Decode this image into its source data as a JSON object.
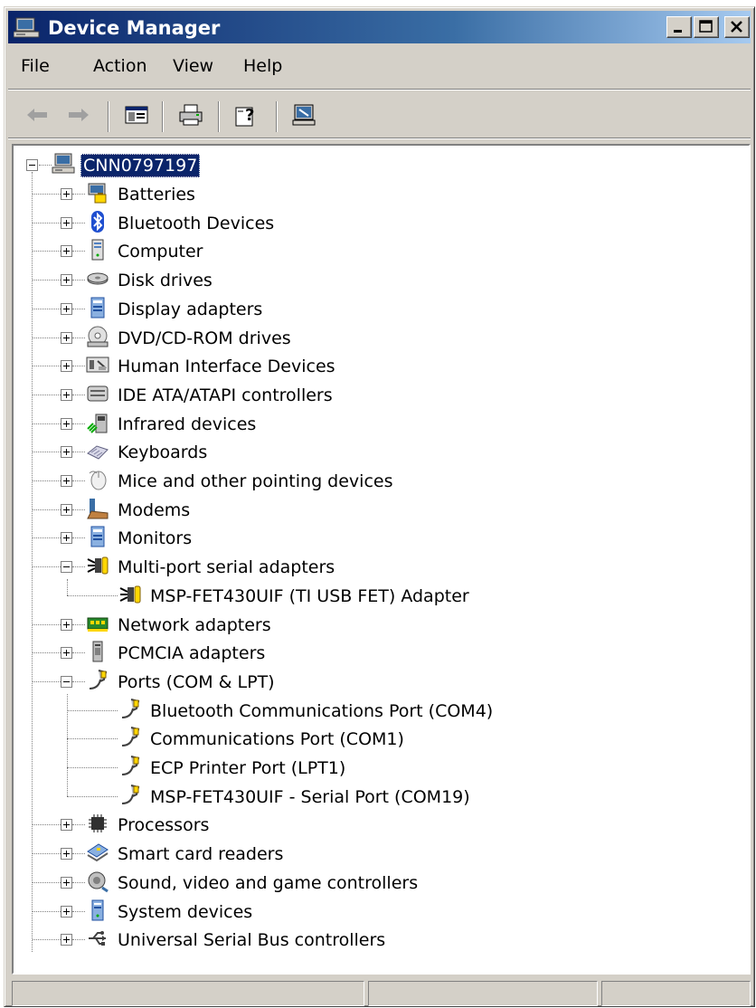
{
  "window": {
    "title": "Device Manager",
    "controls": [
      "minimize",
      "maximize",
      "close"
    ]
  },
  "menu": {
    "file": "File",
    "action": "Action",
    "view": "View",
    "help": "Help"
  },
  "toolbar": {
    "buttons": [
      "back-icon",
      "forward-icon",
      "show-hide-tree-icon",
      "print-icon",
      "help-icon",
      "properties-icon"
    ]
  },
  "tree": {
    "root": "CNN0797197",
    "nodes": [
      {
        "label": "Batteries",
        "icon": "battery-icon",
        "expanded": false
      },
      {
        "label": "Bluetooth Devices",
        "icon": "bluetooth-icon",
        "expanded": false
      },
      {
        "label": "Computer",
        "icon": "computer-icon",
        "expanded": false
      },
      {
        "label": "Disk drives",
        "icon": "disk-drive-icon",
        "expanded": false
      },
      {
        "label": "Display adapters",
        "icon": "display-adapter-icon",
        "expanded": false
      },
      {
        "label": "DVD/CD-ROM drives",
        "icon": "dvd-icon",
        "expanded": false
      },
      {
        "label": "Human Interface Devices",
        "icon": "hid-icon",
        "expanded": false
      },
      {
        "label": "IDE ATA/ATAPI controllers",
        "icon": "ide-controller-icon",
        "expanded": false
      },
      {
        "label": "Infrared devices",
        "icon": "infrared-icon",
        "expanded": false
      },
      {
        "label": "Keyboards",
        "icon": "keyboard-icon",
        "expanded": false
      },
      {
        "label": "Mice and other pointing devices",
        "icon": "mouse-icon",
        "expanded": false
      },
      {
        "label": "Modems",
        "icon": "modem-icon",
        "expanded": false
      },
      {
        "label": "Monitors",
        "icon": "monitor-icon",
        "expanded": false
      },
      {
        "label": "Multi-port serial adapters",
        "icon": "serial-adapter-icon",
        "expanded": true,
        "children": [
          {
            "label": "MSP-FET430UIF (TI USB FET) Adapter",
            "icon": "serial-adapter-icon"
          }
        ]
      },
      {
        "label": "Network adapters",
        "icon": "network-adapter-icon",
        "expanded": false
      },
      {
        "label": "PCMCIA adapters",
        "icon": "pcmcia-icon",
        "expanded": false
      },
      {
        "label": "Ports (COM & LPT)",
        "icon": "port-icon",
        "expanded": true,
        "children": [
          {
            "label": "Bluetooth Communications Port (COM4)",
            "icon": "port-icon"
          },
          {
            "label": "Communications Port (COM1)",
            "icon": "port-icon"
          },
          {
            "label": "ECP Printer Port (LPT1)",
            "icon": "port-icon"
          },
          {
            "label": "MSP-FET430UIF - Serial Port (COM19)",
            "icon": "port-icon"
          }
        ]
      },
      {
        "label": "Processors",
        "icon": "processor-icon",
        "expanded": false
      },
      {
        "label": "Smart card readers",
        "icon": "smart-card-icon",
        "expanded": false
      },
      {
        "label": "Sound, video and game controllers",
        "icon": "sound-icon",
        "expanded": false
      },
      {
        "label": "System devices",
        "icon": "system-devices-icon",
        "expanded": false
      },
      {
        "label": "Universal Serial Bus controllers",
        "icon": "usb-icon",
        "expanded": false
      }
    ]
  },
  "colors": {
    "titlebar_start": "#0a246a",
    "titlebar_end": "#a6caf0",
    "face": "#d4d0c8",
    "selection": "#0a246a"
  }
}
